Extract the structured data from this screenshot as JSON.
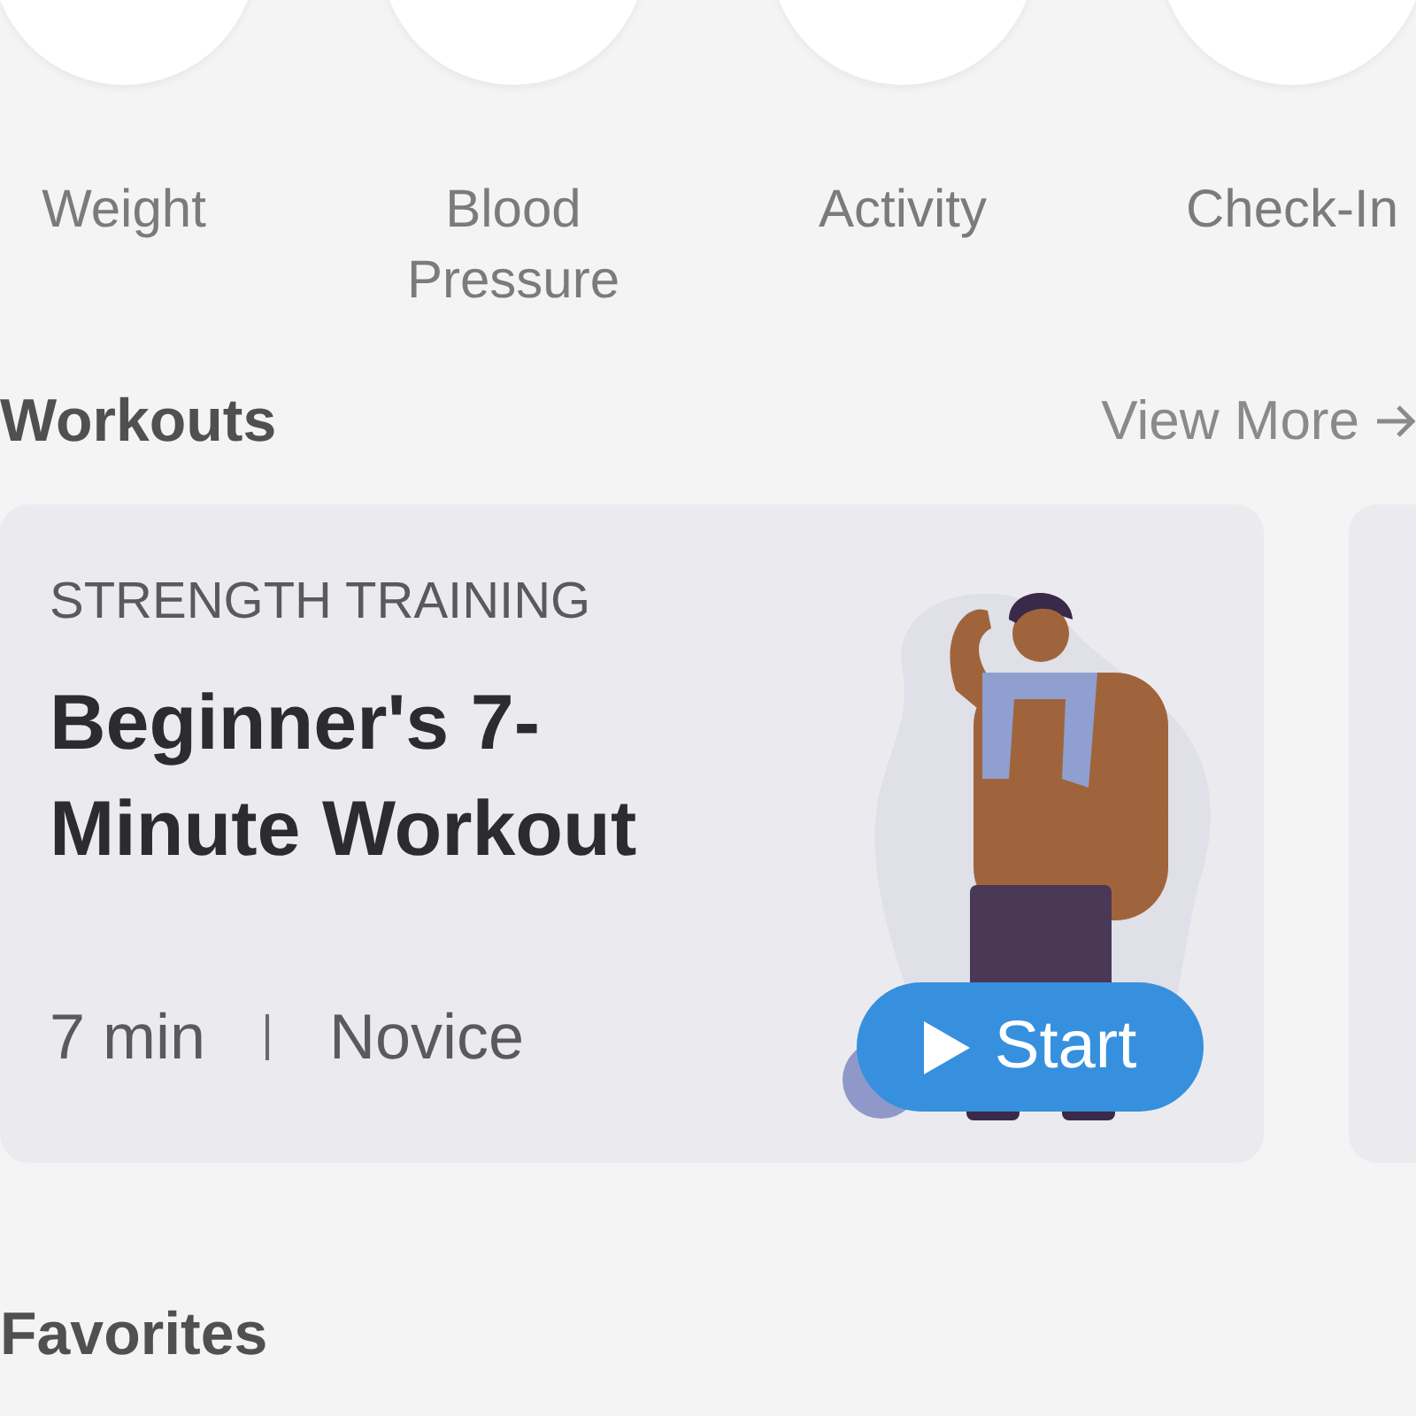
{
  "categories": [
    {
      "label": "Weight"
    },
    {
      "label": "Blood Pressure"
    },
    {
      "label": "Activity"
    },
    {
      "label": "Check-In"
    }
  ],
  "workouts": {
    "title": "Workouts",
    "link": "View More",
    "cards": [
      {
        "category": "STRENGTH TRAINING",
        "title": "Beginner's 7-Minute Workout",
        "duration": "7 min",
        "level": "Novice",
        "button": "Start"
      }
    ]
  },
  "favorites": {
    "title": "Favorites"
  }
}
